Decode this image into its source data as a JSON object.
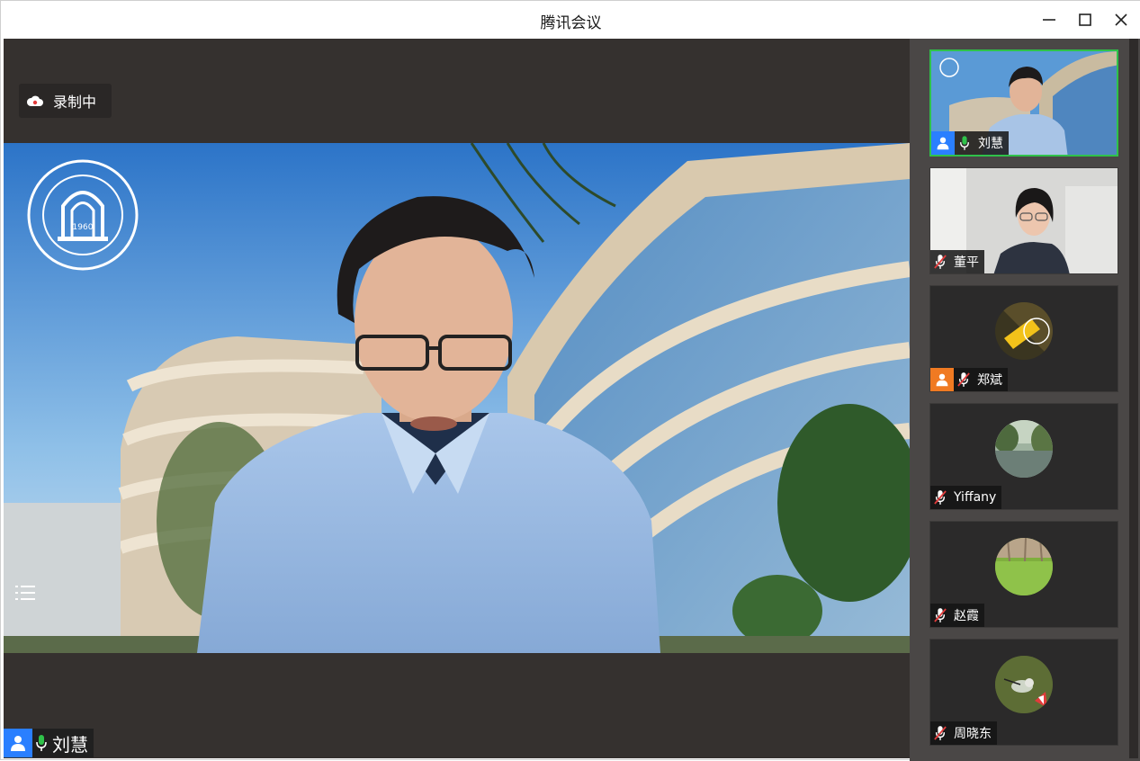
{
  "window": {
    "title": "腾讯会议"
  },
  "stage": {
    "recording_label": "录制中",
    "speaker_name": "刘慧",
    "logo_year": "1960"
  },
  "participants": [
    {
      "name": "刘慧",
      "mic": "on",
      "role_badge": "host",
      "badge_color": "#2a7fff",
      "tile": "video"
    },
    {
      "name": "董平",
      "mic": "muted",
      "role_badge": "",
      "tile": "video"
    },
    {
      "name": "郑斌",
      "mic": "muted",
      "role_badge": "cohost",
      "badge_color": "#f07a22",
      "tile": "avatar"
    },
    {
      "name": "Yiffany",
      "mic": "muted",
      "role_badge": "",
      "tile": "avatar"
    },
    {
      "name": "赵霞",
      "mic": "muted",
      "role_badge": "",
      "tile": "avatar"
    },
    {
      "name": "周晓东",
      "mic": "muted",
      "role_badge": "",
      "tile": "avatar"
    }
  ],
  "colors": {
    "active_border": "#2fc24a",
    "mic_on": "#2fc24a",
    "stage_bg": "#35312f",
    "sidebar_bg": "#4a4746"
  }
}
